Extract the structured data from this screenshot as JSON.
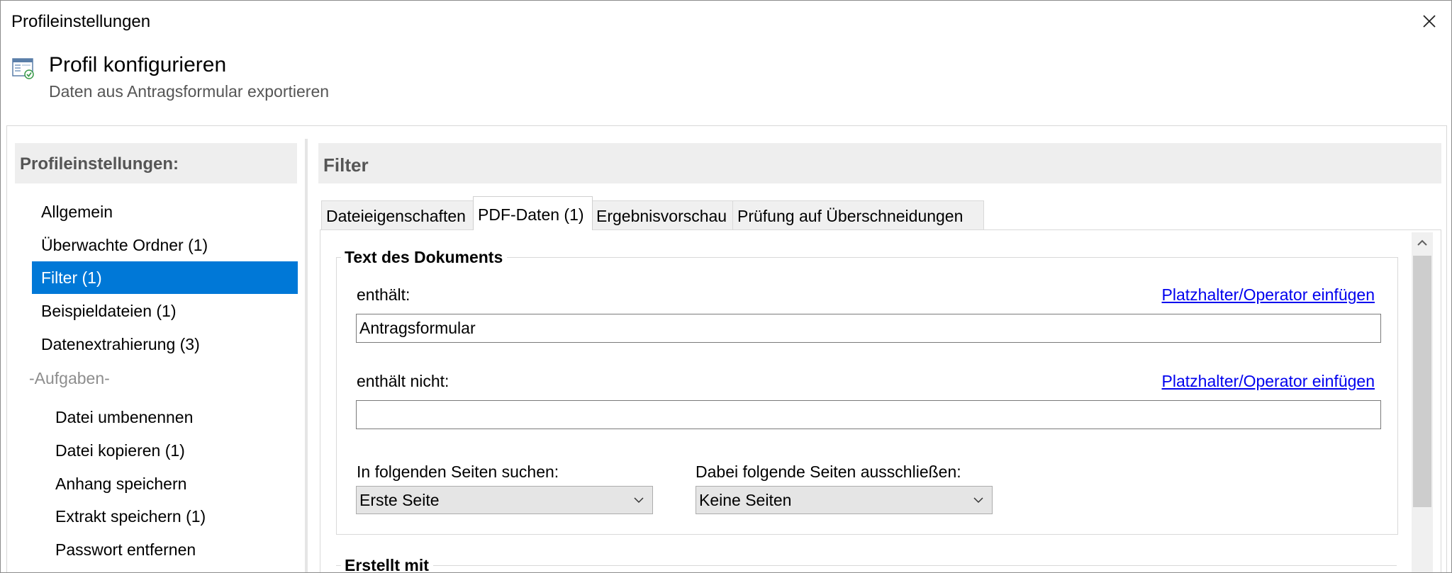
{
  "window": {
    "title": "Profileinstellungen"
  },
  "header": {
    "title": "Profil konfigurieren",
    "subtitle": "Daten aus Antragsformular exportieren"
  },
  "sidebar": {
    "header": "Profileinstellungen:",
    "items": [
      {
        "label": "Allgemein"
      },
      {
        "label": "Überwachte Ordner (1)"
      },
      {
        "label": "Filter (1)",
        "selected": true
      },
      {
        "label": "Beispieldateien (1)"
      },
      {
        "label": "Datenextrahierung (3)"
      }
    ],
    "group_label": "-Aufgaben-",
    "tasks": [
      {
        "label": "Datei umbenennen"
      },
      {
        "label": "Datei kopieren (1)"
      },
      {
        "label": "Anhang speichern"
      },
      {
        "label": "Extrakt speichern (1)"
      },
      {
        "label": "Passwort entfernen"
      }
    ]
  },
  "main": {
    "header": "Filter",
    "tabs": [
      {
        "label": "Dateieigenschaften"
      },
      {
        "label": "PDF-Daten (1)",
        "active": true
      },
      {
        "label": "Ergebnisvorschau"
      },
      {
        "label": "Prüfung auf Überschneidungen"
      }
    ],
    "document_text_group": {
      "title": "Text des Dokuments",
      "contains_label": "enthält:",
      "contains_value": "Antragsformular",
      "insert_link_1": "Platzhalter/Operator einfügen",
      "not_contains_label": "enthält nicht:",
      "not_contains_value": "",
      "insert_link_2": "Platzhalter/Operator einfügen",
      "search_pages_label": "In folgenden Seiten suchen:",
      "search_pages_value": "Erste Seite",
      "exclude_pages_label": "Dabei folgende Seiten ausschließen:",
      "exclude_pages_value": "Keine Seiten"
    },
    "created_with_group": {
      "title": "Erstellt mit"
    }
  },
  "colors": {
    "accent": "#0078d7",
    "link": "#0000ee",
    "section_bg": "#eeeeee"
  },
  "icons": [
    "close-icon",
    "profile-settings-icon",
    "chevron-down-icon",
    "scroll-up-icon"
  ]
}
